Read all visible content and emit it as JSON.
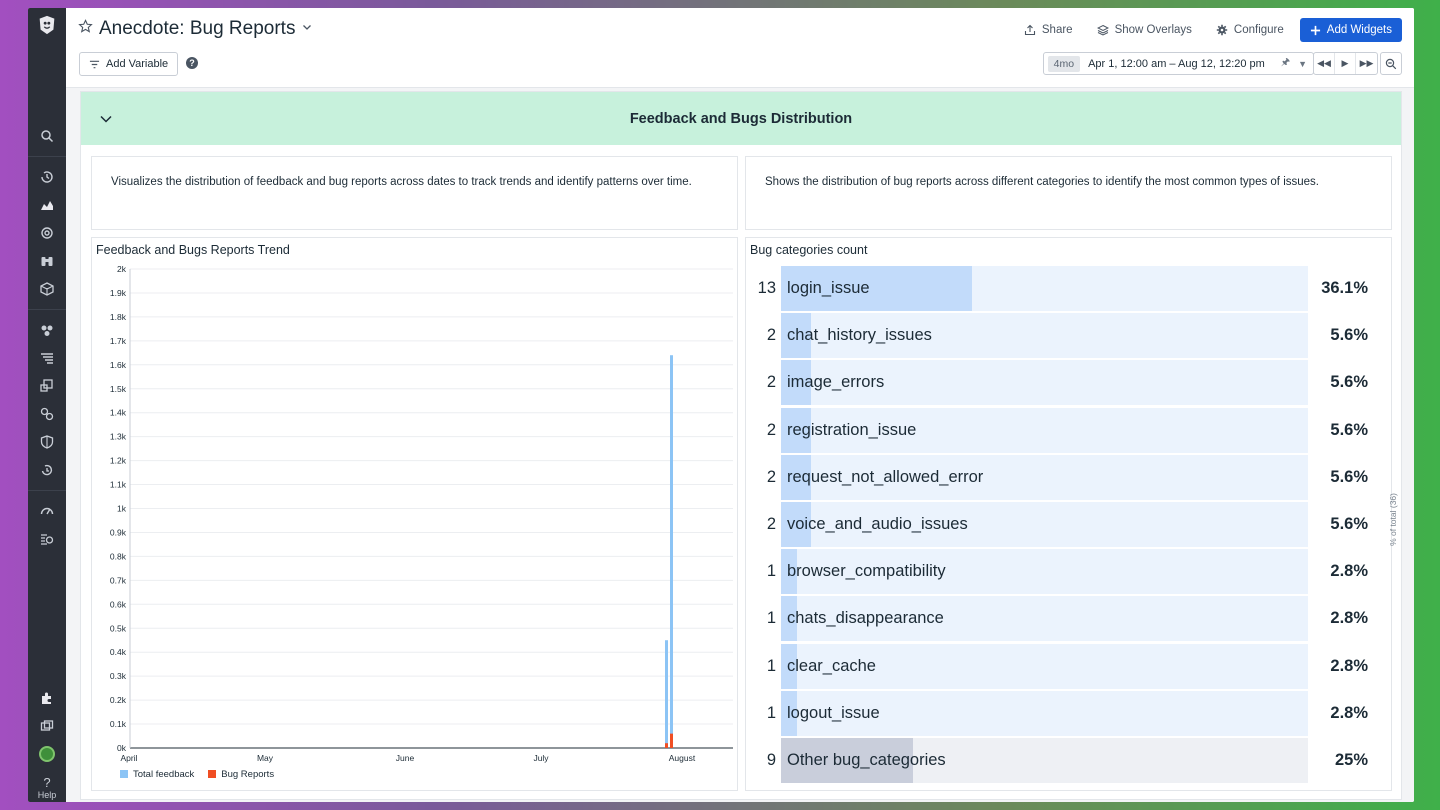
{
  "dashboard": {
    "title": "Anecdote: Bug Reports",
    "actions": {
      "share": "Share",
      "overlays": "Show Overlays",
      "configure": "Configure",
      "add_widgets": "Add Widgets"
    },
    "add_variable": "Add Variable",
    "help": "?",
    "time": {
      "badge": "4mo",
      "range": "Apr 1, 12:00 am – Aug 12, 12:20 pm"
    }
  },
  "sidebar": {
    "icons": [
      "search-icon",
      "history-icon",
      "dashboards-icon",
      "monitors-icon",
      "binoculars-icon",
      "infrastructure-icon",
      "apm-icon",
      "logs-icon",
      "integrations-icon",
      "security-icon",
      "ci-icon",
      "slo-icon",
      "watchdog-icon",
      "extensions-icon",
      "teams-icon"
    ],
    "help_label": "Help",
    "help_glyph": "?"
  },
  "group": {
    "title": "Feedback and Bugs Distribution",
    "notes": [
      "Visualizes the distribution of feedback and bug reports across dates to track trends and identify patterns over time.",
      "Shows the distribution of bug reports across different categories to identify the most common types of issues."
    ]
  },
  "trend": {
    "title": "Feedback and Bugs Reports Trend",
    "legend": [
      "Total feedback",
      "Bug Reports"
    ]
  },
  "categories": {
    "title": "Bug categories count",
    "axis_label": "% of total (36)",
    "rows": [
      {
        "count": "13",
        "label": "login_issue",
        "pct": "36.1%",
        "share": 0.361
      },
      {
        "count": "2",
        "label": "chat_history_issues",
        "pct": "5.6%",
        "share": 0.056
      },
      {
        "count": "2",
        "label": "image_errors",
        "pct": "5.6%",
        "share": 0.056
      },
      {
        "count": "2",
        "label": "registration_issue",
        "pct": "5.6%",
        "share": 0.056
      },
      {
        "count": "2",
        "label": "request_not_allowed_error",
        "pct": "5.6%",
        "share": 0.056
      },
      {
        "count": "2",
        "label": "voice_and_audio_issues",
        "pct": "5.6%",
        "share": 0.056
      },
      {
        "count": "1",
        "label": "browser_compatibility",
        "pct": "2.8%",
        "share": 0.028
      },
      {
        "count": "1",
        "label": "chats_disappearance",
        "pct": "2.8%",
        "share": 0.028
      },
      {
        "count": "1",
        "label": "clear_cache",
        "pct": "2.8%",
        "share": 0.028
      },
      {
        "count": "1",
        "label": "logout_issue",
        "pct": "2.8%",
        "share": 0.028
      },
      {
        "count": "9",
        "label": "Other bug_categories",
        "pct": "25%",
        "share": 0.25,
        "other": true
      }
    ]
  },
  "colors": {
    "accent": "#1a5fd6",
    "group_header": "#c7f1dc",
    "total_feedback": "#8cc4f5",
    "bug_reports": "#f04e23",
    "toplist_bar": "#c2dbfa"
  },
  "chart_data": {
    "type": "bar",
    "title": "Feedback and Bugs Reports Trend",
    "xlabel": "",
    "ylabel": "",
    "ylim": [
      0,
      2000
    ],
    "yticks": [
      "0k",
      "0.1k",
      "0.2k",
      "0.3k",
      "0.4k",
      "0.5k",
      "0.6k",
      "0.7k",
      "0.8k",
      "0.9k",
      "1k",
      "1.1k",
      "1.2k",
      "1.3k",
      "1.4k",
      "1.5k",
      "1.6k",
      "1.7k",
      "1.8k",
      "1.9k",
      "2k"
    ],
    "xticks": [
      "April",
      "May",
      "June",
      "July",
      "August"
    ],
    "x": [
      "Jul 30",
      "Jul 31"
    ],
    "series": [
      {
        "name": "Total feedback",
        "values": [
          450,
          1640
        ]
      },
      {
        "name": "Bug Reports",
        "values": [
          20,
          60
        ]
      }
    ],
    "grid": true,
    "legend": "bottom-left"
  }
}
